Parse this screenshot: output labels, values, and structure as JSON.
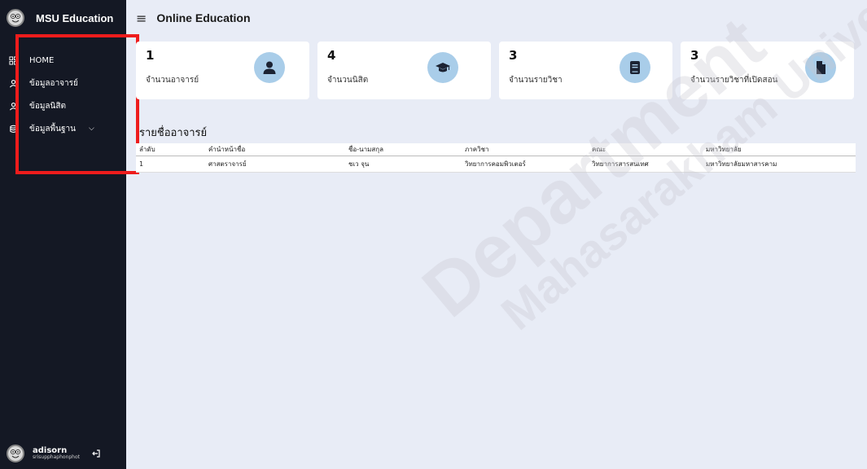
{
  "brand": {
    "name": "MSU Education"
  },
  "header": {
    "title": "Online Education"
  },
  "sidebar": {
    "items": [
      {
        "label": "HOME",
        "icon": "grid-icon"
      },
      {
        "label": "ข้อมูลอาจารย์",
        "icon": "user-icon"
      },
      {
        "label": "ข้อมูลนิสิต",
        "icon": "user-icon"
      },
      {
        "label": "ข้อมูลพื้นฐาน",
        "icon": "database-icon"
      }
    ]
  },
  "user": {
    "name": "adisorn",
    "subtitle": "srisupphaphonphot"
  },
  "cards": [
    {
      "value": "1",
      "label": "จำนวนอาจารย์",
      "icon": "user-icon"
    },
    {
      "value": "4",
      "label": "จำนวนนิสิต",
      "icon": "graduation-cap-icon"
    },
    {
      "value": "3",
      "label": "จำนวนรายวิชา",
      "icon": "book-icon"
    },
    {
      "value": "3",
      "label": "จำนวนรายวิชาที่เปิดสอน",
      "icon": "file-icon"
    }
  ],
  "section": {
    "title": "รายชื่ออาจารย์"
  },
  "table": {
    "headers": [
      "ลำดับ",
      "คำนำหน้าชื่อ",
      "ชื่อ-นามสกุล",
      "ภาควิชา",
      "คณะ",
      "มหาวิทยาลัย"
    ],
    "rows": [
      [
        "1",
        "ศาสตราจารย์",
        "ชเว จุน",
        "วิทยาการคอมพิวเตอร์",
        "วิทยาการสารสนเทศ",
        "มหาวิทยาลัยมหาสารคาม"
      ]
    ]
  },
  "watermark": {
    "line1": "Department",
    "line2": "Mahasarakham University"
  },
  "colors": {
    "sidebar": "#141824",
    "background": "#e8ecf6",
    "icon_circle": "#a9cde9",
    "highlight": "#ee1c1c"
  }
}
